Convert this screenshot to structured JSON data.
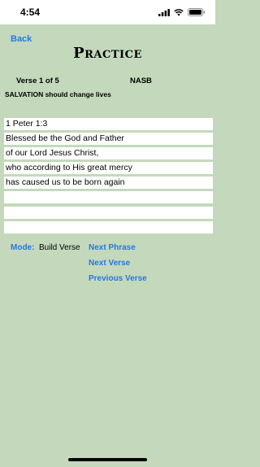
{
  "status_bar": {
    "time": "4:54",
    "icons": [
      "signal-icon",
      "wifi-icon",
      "battery-icon"
    ]
  },
  "nav": {
    "back_label": "Back"
  },
  "page": {
    "title": "Practice",
    "verse_count": "Verse 1 of 5",
    "translation": "NASB",
    "theme": "SALVATION should change lives"
  },
  "verse": {
    "lines": [
      "1 Peter 1:3",
      "Blessed be the God and Father",
      "of our Lord Jesus Christ,",
      "who according to His great mercy",
      "has caused us to be born again",
      "",
      "",
      ""
    ]
  },
  "controls": {
    "mode_label": "Mode:",
    "mode_value": "Build Verse",
    "next_phrase": "Next Phrase",
    "next_verse": "Next Verse",
    "previous_verse": "Previous Verse"
  },
  "colors": {
    "background": "#c4d9bc",
    "accent": "#2478e0"
  }
}
